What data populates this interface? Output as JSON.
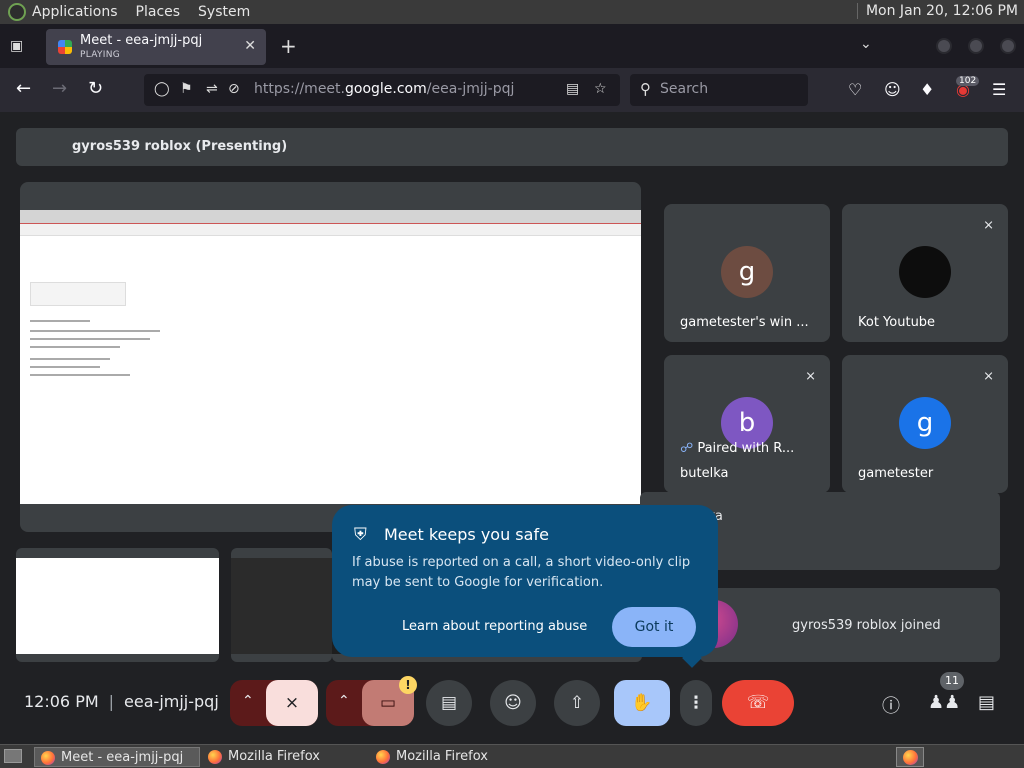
{
  "system_panel": {
    "menus": [
      "Applications",
      "Places",
      "System"
    ],
    "clock": "Mon Jan 20, 12:06 PM"
  },
  "browser": {
    "tab": {
      "title": "Meet - eea-jmjj-pqj",
      "subtitle": "PLAYING"
    },
    "url_prefix": "https://meet.",
    "url_domain": "google.com",
    "url_path": "/eea-jmjj-pqj",
    "search_placeholder": "Search",
    "extension_badge": "102"
  },
  "meet": {
    "presenting_label": "gyros539 roblox (Presenting)",
    "participants": [
      {
        "name": "gametester's win ...",
        "initial": "g",
        "color": "#6d4c41",
        "muted": false
      },
      {
        "name": "Kot Youtube",
        "initial": "",
        "color": "#111111",
        "muted": true
      },
      {
        "name": "butelka",
        "initial": "b",
        "color": "#7e57c2",
        "muted": true,
        "paired": "Paired with R..."
      },
      {
        "name": "gametester",
        "initial": "g",
        "color": "#1a73e8",
        "muted": true
      }
    ],
    "notice_partial": "lka",
    "joined_text": "gyros539 roblox joined",
    "popup": {
      "title": "Meet keeps you safe",
      "body": "If abuse is reported on a call, a short video-only clip may be sent to Google for verification.",
      "learn_link": "Learn about reporting abuse",
      "got_it": "Got it"
    },
    "controls": {
      "time": "12:06 PM",
      "meeting_code": "eea-jmjj-pqj",
      "people_count": "11",
      "camera_warning": "!"
    }
  },
  "taskbar": {
    "tasks": [
      "Meet - eea-jmjj-pqj ...",
      "Mozilla Firefox",
      "Mozilla Firefox"
    ]
  }
}
